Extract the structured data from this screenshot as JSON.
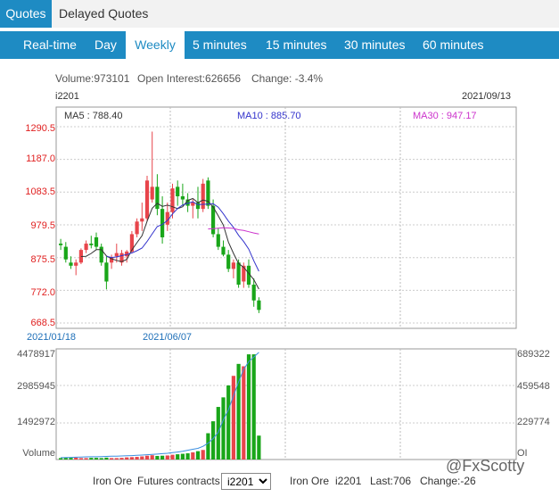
{
  "top_tabs": [
    "Quotes",
    "Delayed Quotes"
  ],
  "periods": [
    "Real-time",
    "Day",
    "Weekly",
    "5 minutes",
    "15 minutes",
    "30 minutes",
    "60 minutes"
  ],
  "active_period": "Weekly",
  "info": {
    "volume": "Volume:973101",
    "open_interest": "Open Interest:626656",
    "change": "Change: -3.4%",
    "symbol": "i2201",
    "date": "2021/09/13"
  },
  "ma": {
    "ma5": "MA5 : 788.40",
    "ma10": "MA10 : 885.70",
    "ma30": "MA30 : 947.17"
  },
  "colors": {
    "accent": "#1e8bc3",
    "up": "#e8454b",
    "down": "#19a619",
    "ma5": "#333333",
    "ma10": "#3333cc",
    "ma30": "#cc33cc"
  },
  "price_axis": [
    "1290.5",
    "1187.0",
    "1083.5",
    "979.5",
    "875.5",
    "772.0",
    "668.5"
  ],
  "date_labels": [
    "2021/01/18",
    "2021/06/07"
  ],
  "vol_axis_left": [
    "4478917",
    "2985945",
    "1492972",
    "Volume"
  ],
  "vol_axis_right": [
    "689322",
    "459548",
    "229774",
    "OI"
  ],
  "bottom": {
    "product": "Iron Ore",
    "futures": "Futures contracts",
    "selected": "i2201",
    "quote_product": "Iron Ore",
    "quote_symbol": "i2201",
    "last": "Last:706",
    "change": "Change:-26"
  },
  "watermark": "@FxScotty",
  "chart_data": {
    "type": "candlestick",
    "ylim": [
      668.5,
      1290.5
    ],
    "candles": [
      {
        "o": 920,
        "h": 935,
        "l": 900,
        "c": 915
      },
      {
        "o": 910,
        "h": 925,
        "l": 860,
        "c": 870
      },
      {
        "o": 860,
        "h": 880,
        "l": 840,
        "c": 850
      },
      {
        "o": 850,
        "h": 870,
        "l": 820,
        "c": 860
      },
      {
        "o": 860,
        "h": 905,
        "l": 855,
        "c": 900
      },
      {
        "o": 900,
        "h": 930,
        "l": 890,
        "c": 920
      },
      {
        "o": 920,
        "h": 945,
        "l": 905,
        "c": 915
      },
      {
        "o": 940,
        "h": 955,
        "l": 900,
        "c": 910
      },
      {
        "o": 910,
        "h": 920,
        "l": 850,
        "c": 860
      },
      {
        "o": 860,
        "h": 880,
        "l": 775,
        "c": 800
      },
      {
        "o": 860,
        "h": 885,
        "l": 840,
        "c": 875
      },
      {
        "o": 880,
        "h": 920,
        "l": 860,
        "c": 890
      },
      {
        "o": 860,
        "h": 900,
        "l": 850,
        "c": 890
      },
      {
        "o": 880,
        "h": 900,
        "l": 860,
        "c": 895
      },
      {
        "o": 895,
        "h": 960,
        "l": 890,
        "c": 950
      },
      {
        "o": 950,
        "h": 1000,
        "l": 940,
        "c": 990
      },
      {
        "o": 990,
        "h": 1050,
        "l": 960,
        "c": 1000
      },
      {
        "o": 1000,
        "h": 1135,
        "l": 990,
        "c": 1120
      },
      {
        "o": 1060,
        "h": 1275,
        "l": 1050,
        "c": 1100
      },
      {
        "o": 1100,
        "h": 1140,
        "l": 1010,
        "c": 1030
      },
      {
        "o": 1030,
        "h": 1070,
        "l": 920,
        "c": 940
      },
      {
        "o": 980,
        "h": 1050,
        "l": 960,
        "c": 1020
      },
      {
        "o": 1020,
        "h": 1110,
        "l": 1000,
        "c": 1095
      },
      {
        "o": 1100,
        "h": 1120,
        "l": 1040,
        "c": 1070
      },
      {
        "o": 1070,
        "h": 1110,
        "l": 1040,
        "c": 1060
      },
      {
        "o": 1060,
        "h": 1080,
        "l": 1020,
        "c": 1040
      },
      {
        "o": 1040,
        "h": 1060,
        "l": 1000,
        "c": 1050
      },
      {
        "o": 1050,
        "h": 1100,
        "l": 1000,
        "c": 1030
      },
      {
        "o": 1030,
        "h": 1125,
        "l": 1020,
        "c": 1110
      },
      {
        "o": 1120,
        "h": 1130,
        "l": 1030,
        "c": 1040
      },
      {
        "o": 1040,
        "h": 1060,
        "l": 940,
        "c": 950
      },
      {
        "o": 950,
        "h": 970,
        "l": 900,
        "c": 910
      },
      {
        "o": 910,
        "h": 930,
        "l": 880,
        "c": 885
      },
      {
        "o": 885,
        "h": 900,
        "l": 830,
        "c": 840
      },
      {
        "o": 840,
        "h": 870,
        "l": 810,
        "c": 860
      },
      {
        "o": 860,
        "h": 870,
        "l": 780,
        "c": 790
      },
      {
        "o": 800,
        "h": 860,
        "l": 780,
        "c": 850
      },
      {
        "o": 850,
        "h": 870,
        "l": 780,
        "c": 790
      },
      {
        "o": 790,
        "h": 810,
        "l": 720,
        "c": 740
      },
      {
        "o": 740,
        "h": 750,
        "l": 700,
        "c": 710
      }
    ],
    "volume_ylim": [
      0,
      4478917
    ],
    "volume": [
      60000,
      70000,
      70000,
      80000,
      60000,
      60000,
      70000,
      70000,
      60000,
      80000,
      60000,
      60000,
      70000,
      90000,
      100000,
      110000,
      130000,
      160000,
      180000,
      150000,
      160000,
      170000,
      200000,
      220000,
      240000,
      260000,
      300000,
      350000,
      400000,
      1100000,
      1600000,
      2200000,
      2600000,
      3100000,
      3500000,
      4000000,
      3900000,
      4400000,
      4400000,
      1000000
    ],
    "oi_ylim": [
      0,
      689322
    ],
    "oi": [
      12000,
      13000,
      14000,
      15000,
      16000,
      17000,
      18000,
      18000,
      19000,
      20000,
      21000,
      22000,
      23000,
      24000,
      25000,
      27000,
      29000,
      31000,
      33000,
      35000,
      38000,
      40000,
      44000,
      48000,
      53000,
      60000,
      66000,
      72000,
      85000,
      105000,
      135000,
      175000,
      255000,
      320000,
      410000,
      500000,
      580000,
      630000,
      660000,
      690000
    ]
  }
}
